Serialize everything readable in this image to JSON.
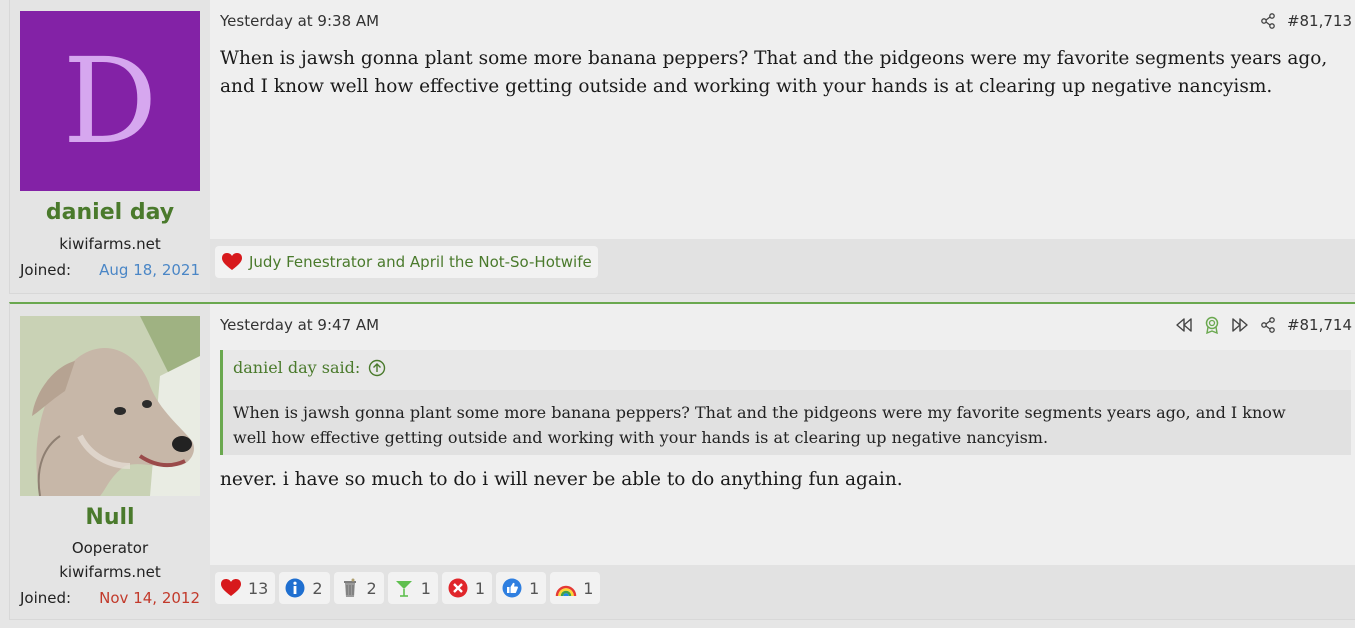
{
  "posts": [
    {
      "user": {
        "avatar_letter": "D",
        "name": "daniel day",
        "site": "kiwifarms.net",
        "joined_label": "Joined:",
        "joined_date": "Aug 18, 2021"
      },
      "date": "Yesterday at 9:38 AM",
      "post_number": "#81,713",
      "body": "When is jawsh gonna plant some more banana peppers? That and the pidgeons were my favorite segments years ago, and I know well how effective getting outside and working with your hands is at clearing up negative nancyism.",
      "reaction_summary": "Judy Fenestrator and April the Not-So-Hotwife"
    },
    {
      "user": {
        "name": "Null",
        "title": "Ooperator",
        "site": "kiwifarms.net",
        "joined_label": "Joined:",
        "joined_date": "Nov 14, 2012"
      },
      "date": "Yesterday at 9:47 AM",
      "post_number": "#81,714",
      "quote": {
        "author": "daniel day said:",
        "text": "When is jawsh gonna plant some more banana peppers? That and the pidgeons were my favorite segments years ago, and I know well how effective getting outside and working with your hands is at clearing up negative nancyism."
      },
      "body": "never. i have so much to do i will never be able to do anything fun again.",
      "reactions": [
        {
          "icon": "heart-icon",
          "count": "13"
        },
        {
          "icon": "info-icon",
          "count": "2"
        },
        {
          "icon": "trash-can-icon",
          "count": "2"
        },
        {
          "icon": "martini-icon",
          "count": "1"
        },
        {
          "icon": "x-mark-icon",
          "count": "1"
        },
        {
          "icon": "thumbs-up-icon",
          "count": "1"
        },
        {
          "icon": "rainbow-icon",
          "count": "1"
        }
      ]
    }
  ],
  "colors": {
    "accent_green": "#4a7a2c",
    "avatar_purple": "#8322a6",
    "joined_blue": "#4a86c6",
    "joined_red": "#c23a2b"
  }
}
